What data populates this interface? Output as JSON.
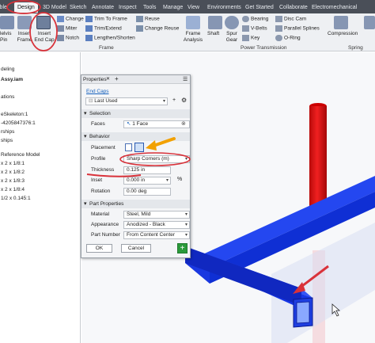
{
  "tabs": [
    "ible",
    "Design",
    "3D Model",
    "Sketch",
    "Annotate",
    "Inspect",
    "Tools",
    "Manage",
    "View",
    "Environments",
    "Get Started",
    "Collaborate",
    "Electromechanical"
  ],
  "ribbon": {
    "insert_frame": "Insert Frame",
    "insert_end_cap": "Insert End Cap",
    "helvis_pin": "lelvis Pin",
    "change": "Change",
    "miter": "Miter",
    "notch": "Notch",
    "trim_to_frame": "Trim To Frame",
    "trim_extend": "Trim/Extend",
    "lengthen_shorten": "Lengthen/Shorten",
    "reuse": "Reuse",
    "change_reuse": "Change Reuse",
    "frame_analysis": "Frame Analysis",
    "shaft": "Shaft",
    "spur_gear": "Spur Gear",
    "bearing": "Bearing",
    "v_belts": "V-Belts",
    "key": "Key",
    "o_ring": "O-Ring",
    "disc_cam": "Disc Cam",
    "parallel_splines": "Parallel Splines",
    "compression": "Compression",
    "frame_panel": "Frame",
    "power_transmission_panel": "Power Transmission",
    "spring_panel": "Spring"
  },
  "browser": {
    "items": [
      "deling",
      "Assy.iam",
      "",
      "ations",
      "",
      "eSkeleton:1",
      "-4205847376:1",
      "rships",
      "ships",
      "",
      "Reference Model",
      "x 2 x 1/8:1",
      "x 2 x 1/8:2",
      "x 2 x 1/8:3",
      "x 2 x 1/8:4",
      "1/2 x 0.145:1"
    ]
  },
  "properties": {
    "title": "Properties",
    "end_caps_link": "End Caps",
    "last_used": "Last Used",
    "selection_section": "Selection",
    "faces_label": "Faces",
    "faces_value": "1 Face",
    "behavior_section": "Behavior",
    "placement_label": "Placement",
    "profile_label": "Profile",
    "profile_value": "Sharp Corners (m)",
    "thickness_label": "Thickness",
    "thickness_value": "0.125 in",
    "inset_label": "Inset",
    "inset_value": "0.000 in",
    "inset_unit": "%",
    "rotation_label": "Rotation",
    "rotation_value": "0.00 deg",
    "part_properties_section": "Part Properties",
    "material_label": "Material",
    "material_value": "Steel, Mild",
    "appearance_label": "Appearance",
    "appearance_value": "Anodized - Black",
    "part_number_label": "Part Number",
    "part_number_value": "From Content Center",
    "ok_label": "OK",
    "cancel_label": "Cancel",
    "add_label": "+"
  },
  "colors": {
    "frame_blue": "#1c3ee6",
    "post_red": "#e01212",
    "annotation_red": "#d9323a",
    "annotation_orange": "#f2a100",
    "link_blue": "#1560bd"
  }
}
